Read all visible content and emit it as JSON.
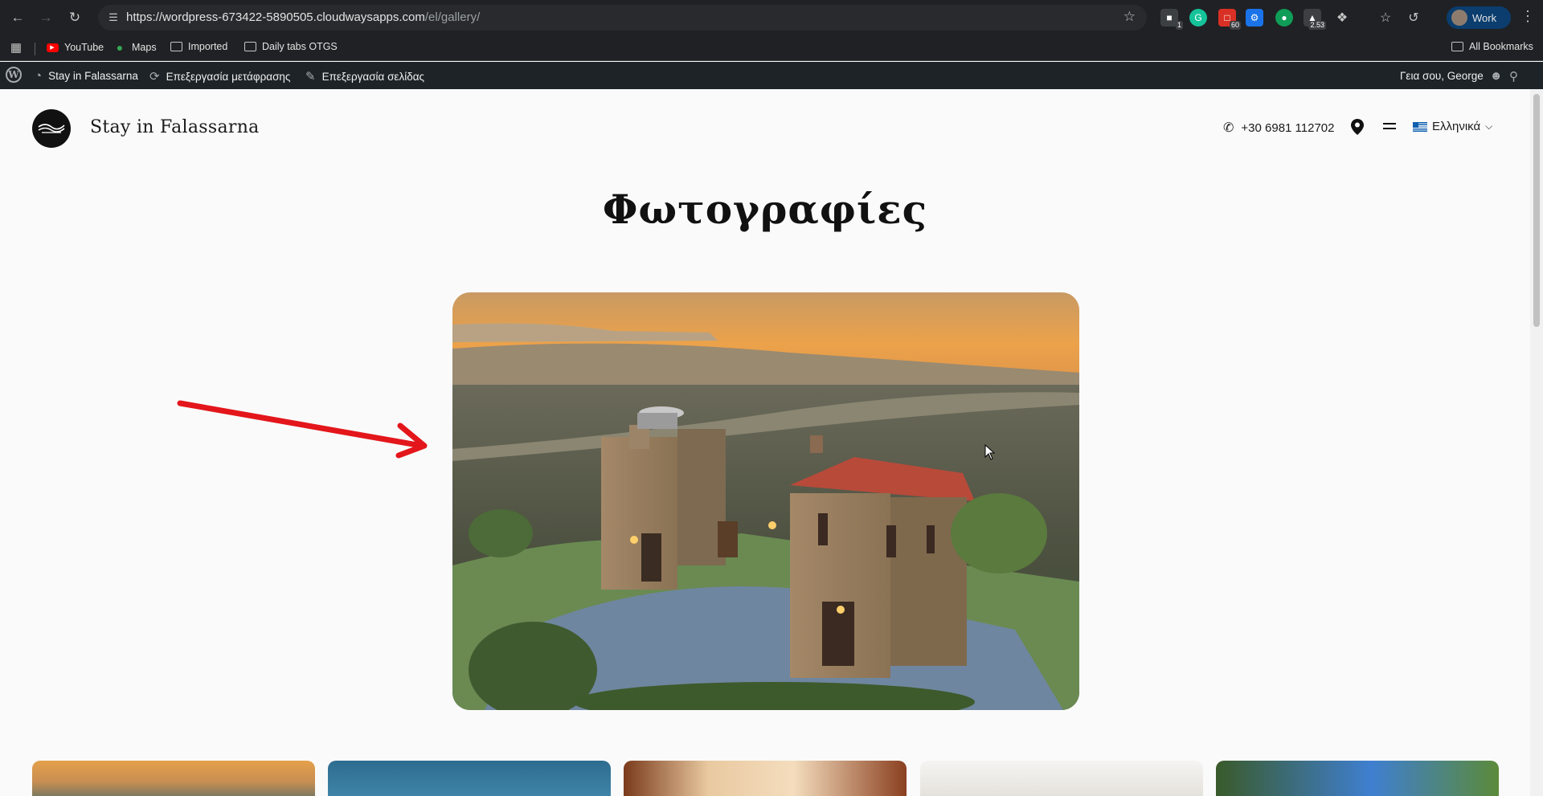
{
  "browser": {
    "url_main": "https://wordpress-673422-5890505.cloudwaysapps.com",
    "url_path": "/el/gallery/",
    "profile_label": "Work",
    "ext_badges": {
      "first": "1",
      "second": "60",
      "third": "2.53"
    }
  },
  "bookmarks": {
    "items": [
      {
        "label": "YouTube",
        "icon": "youtube-icon"
      },
      {
        "label": "Maps",
        "icon": "maps-icon"
      },
      {
        "label": "Imported",
        "icon": "folder-icon"
      },
      {
        "label": "Daily tabs OTGS",
        "icon": "folder-icon"
      }
    ],
    "all_bookmarks": "All Bookmarks"
  },
  "wpbar": {
    "site": "Stay in Falassarna",
    "edit_translation": "Επεξεργασία μετάφρασης",
    "edit_page": "Επεξεργασία σελίδας",
    "greeting": "Γεια σου, George"
  },
  "site": {
    "title": "Stay in Falassarna",
    "phone": "+30 6981 112702",
    "language": "Ελληνικά"
  },
  "page": {
    "title": "Φωτογραφίες"
  },
  "colors": {
    "chrome_bg": "#202124",
    "wpbar_bg": "#1d2327",
    "page_bg": "#fafafa",
    "annotation_arrow": "#e3161b"
  }
}
